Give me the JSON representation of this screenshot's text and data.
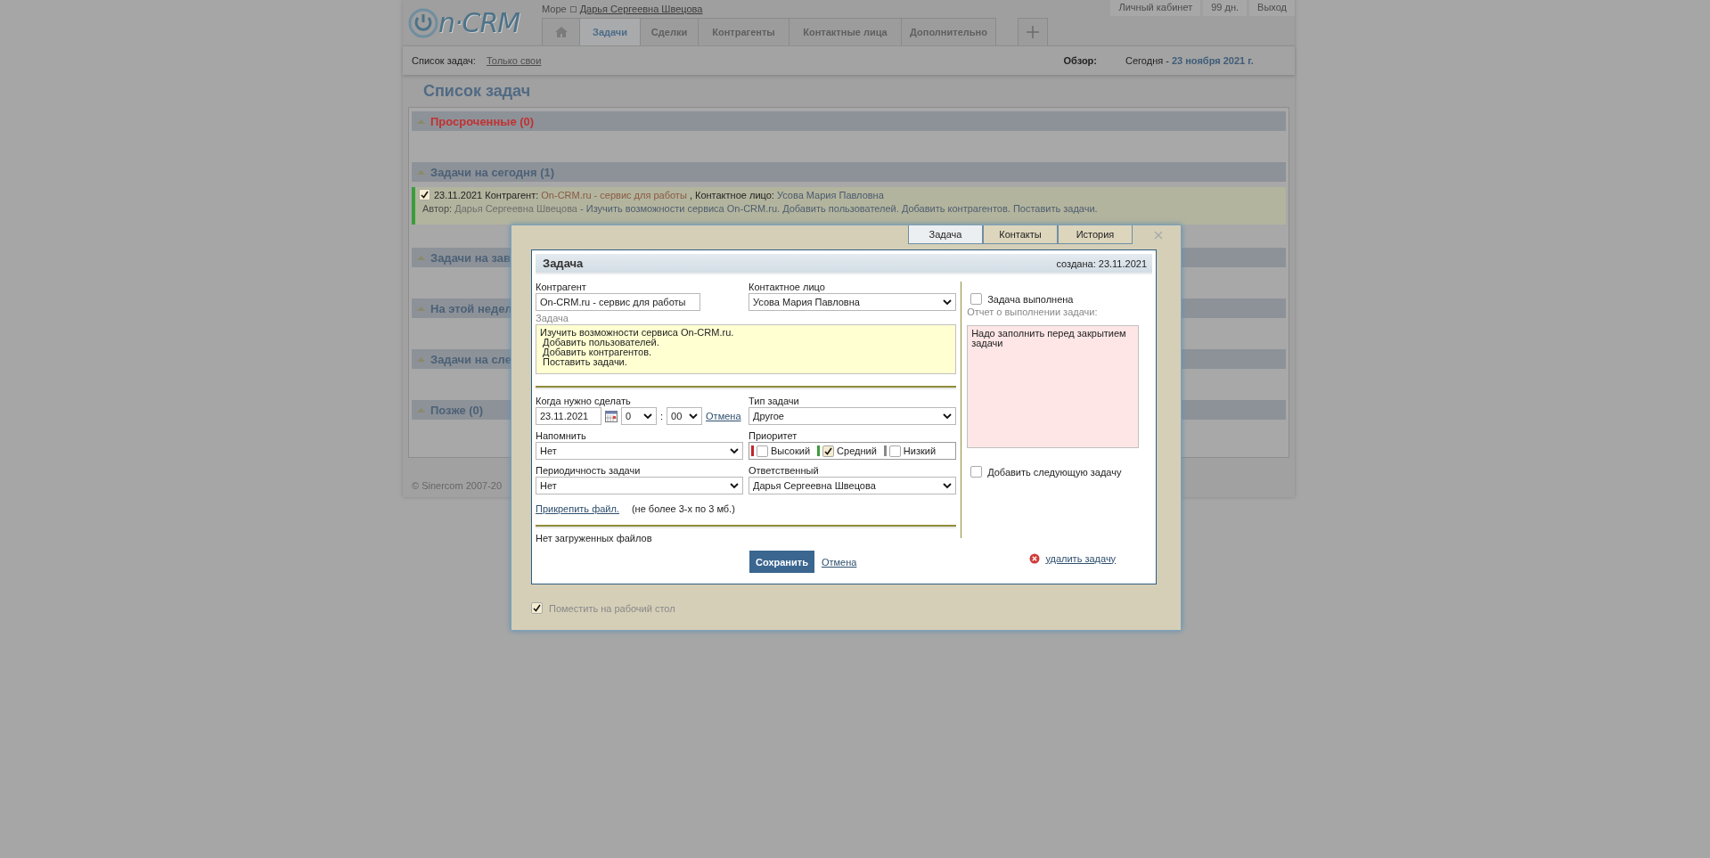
{
  "header": {
    "logo": {
      "text": "n·CRM"
    },
    "breadcrumb": {
      "home": "Море",
      "user": "Дарья Сергеевна Швецова"
    },
    "nav_tabs": [
      {
        "kind": "home",
        "selected": false
      },
      {
        "kind": "text",
        "label": "Задачи",
        "selected": true
      },
      {
        "kind": "text",
        "label": "Сделки",
        "selected": false
      },
      {
        "kind": "text",
        "label": "Контрагенты",
        "selected": false
      },
      {
        "kind": "text",
        "label": "Контактные лица",
        "selected": false
      },
      {
        "kind": "text",
        "label": "Дополнительно",
        "selected": false
      },
      {
        "kind": "add",
        "selected": false
      }
    ],
    "user_links": [
      "Личный кабинет",
      "99 дн.",
      "Выход"
    ]
  },
  "filter_bar": {
    "label": "Список задач:",
    "filter": "Только свои",
    "overview_label": "Обзор:",
    "today": "Сегодня - ",
    "date": "23 ноября 2021 г."
  },
  "page_title": "Список задач",
  "sections": [
    {
      "title": "Просроченные (0)",
      "overdue": true
    },
    {
      "title": "Задачи на сегодня (1)",
      "overdue": false,
      "tasks": [
        {
          "done": true,
          "date": "23.11.2021",
          "contractor_label": "Контрагент:",
          "contractor": "On-CRM.ru - сервис для работы",
          "contact_label": ", Контактное лицо:",
          "contact": "Усова Мария Павловна",
          "author_label": "Автор:",
          "author": "Дарья Сергеевна Швецова",
          "description": "- Изучить возможности сервиса On-CRM.ru. Добавить пользователей. Добавить контрагентов. Поставить задачи."
        }
      ]
    },
    {
      "title": "Задачи на зав",
      "overdue": false
    },
    {
      "title": "На этой недел",
      "overdue": false
    },
    {
      "title": "Задачи на сле",
      "overdue": false
    },
    {
      "title": "Позже (0)",
      "overdue": false
    }
  ],
  "footer": "© Sinercom 2007-20",
  "dialog": {
    "tabs": [
      {
        "label": "Задача",
        "selected": true
      },
      {
        "label": "Контакты",
        "selected": false
      },
      {
        "label": "История",
        "selected": false
      }
    ],
    "title": "Задача",
    "created": "создана: 23.11.2021",
    "contractor": {
      "label": "Контрагент",
      "value": "On-CRM.ru - сервис для работы"
    },
    "contact": {
      "label": "Контактное лицо",
      "value": "Усова Мария Павловна"
    },
    "task": {
      "label": "Задача",
      "value": "Изучить возможности сервиса On-CRM.ru.\n Добавить пользователей.\n Добавить контрагентов.\n Поставить задачи."
    },
    "due": {
      "label": "Когда нужно сделать",
      "date": "23.11.2021",
      "hour": "0",
      "separator": ":",
      "minute": "00",
      "cancel": "Отмена"
    },
    "type": {
      "label": "Тип задачи",
      "value": "Другое"
    },
    "remind": {
      "label": "Напомнить",
      "value": "Нет"
    },
    "priority": {
      "label": "Приоритет",
      "options": [
        {
          "label": "Высокий",
          "color": "#c0262d",
          "checked": false
        },
        {
          "label": "Средний",
          "color": "#3c9c3c",
          "checked": true
        },
        {
          "label": "Низкий",
          "color": "#8a8a8a",
          "checked": false
        }
      ]
    },
    "recurrence": {
      "label": "Периодичность задачи",
      "value": "Нет"
    },
    "responsible": {
      "label": "Ответственный",
      "value": "Дарья Сергеевна Швецова"
    },
    "attach": {
      "link": "Прикрепить файл.",
      "note": "(не более 3-х по 3 мб.)"
    },
    "files_note": "Нет загруженных файлов",
    "save": "Сохранить",
    "cancel": "Отмена",
    "done": {
      "label": "Задача выполнена",
      "checked": false
    },
    "report": {
      "label": "Отчет о выполнении задачи:",
      "value": "Надо заполнить перед закрытием задачи"
    },
    "next_task": {
      "label": "Добавить следующую задачу",
      "checked": false
    },
    "delete": "удалить задачу",
    "desktop": {
      "label": "Поместить на рабочий стол",
      "checked": true
    }
  }
}
